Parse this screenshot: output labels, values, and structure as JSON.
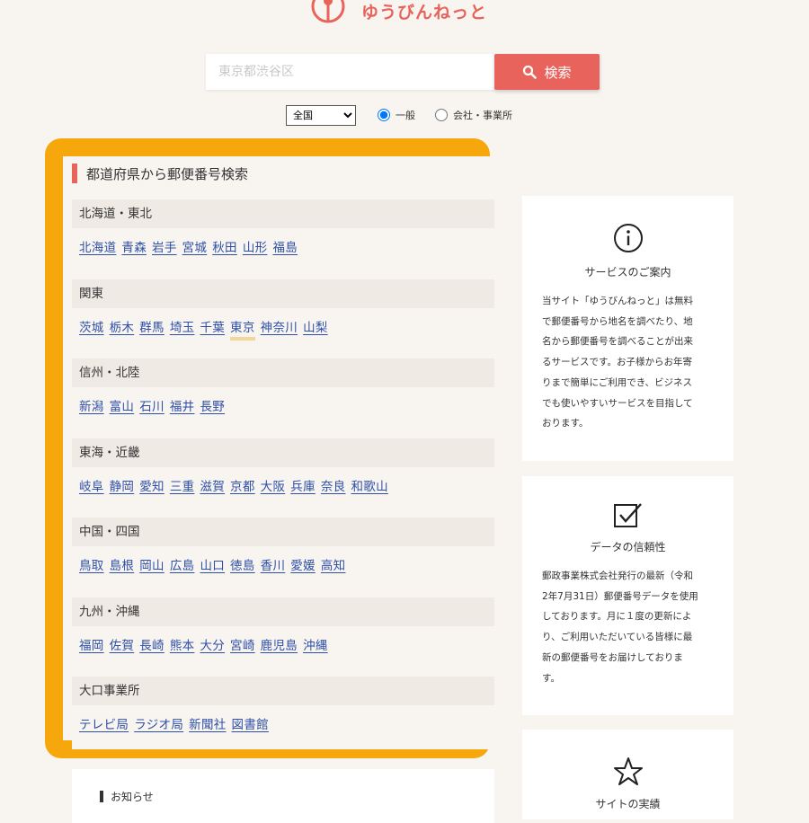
{
  "logo": {
    "text": "ゆうびんねっと"
  },
  "search": {
    "placeholder": "東京都渋谷区",
    "button_label": "検索"
  },
  "options": {
    "area_select": "全国",
    "radio_general": "一般",
    "radio_company": "会社・事業所"
  },
  "panel": {
    "title": "都道府県から郵便番号検索"
  },
  "regions": [
    {
      "name": "北海道・東北",
      "items": [
        "北海道",
        "青森",
        "岩手",
        "宮城",
        "秋田",
        "山形",
        "福島"
      ]
    },
    {
      "name": "関東",
      "items": [
        "茨城",
        "栃木",
        "群馬",
        "埼玉",
        "千葉",
        "東京",
        "神奈川",
        "山梨"
      ]
    },
    {
      "name": "信州・北陸",
      "items": [
        "新潟",
        "富山",
        "石川",
        "福井",
        "長野"
      ]
    },
    {
      "name": "東海・近畿",
      "items": [
        "岐阜",
        "静岡",
        "愛知",
        "三重",
        "滋賀",
        "京都",
        "大阪",
        "兵庫",
        "奈良",
        "和歌山"
      ]
    },
    {
      "name": "中国・四国",
      "items": [
        "鳥取",
        "島根",
        "岡山",
        "広島",
        "山口",
        "徳島",
        "香川",
        "愛媛",
        "高知"
      ]
    },
    {
      "name": "九州・沖縄",
      "items": [
        "福岡",
        "佐賀",
        "長崎",
        "熊本",
        "大分",
        "宮崎",
        "鹿児島",
        "沖縄"
      ]
    },
    {
      "name": "大口事業所",
      "items": [
        "テレビ局",
        "ラジオ局",
        "新聞社",
        "図書館"
      ]
    }
  ],
  "side": {
    "service": {
      "title": "サービスのご案内",
      "icon": "info-icon",
      "lines": [
        "当サイト「ゆうびんねっと」は無料",
        "で郵便番号から地名を調べたり、地",
        "名から郵便番号を調べることが出来",
        "るサービスです。お子様からお年寄",
        "りまで簡単にご利用でき、ビジネス",
        "でも使いやすいサービスを目指して",
        "おります。"
      ]
    },
    "reliability": {
      "title": "データの信頼性",
      "icon": "checkbox-icon",
      "lines": [
        "郵政事業株式会社発行の最新（令和",
        "2年7月31日）郵便番号データを使用",
        "しております。月に１度の更新によ",
        "り、ご利用いただいている皆様に最",
        "新の郵便番号をお届けしておりま",
        "す。"
      ]
    },
    "achievements": {
      "title": "サイトの実績",
      "icon": "star-icon"
    }
  },
  "notice": {
    "title": "お知らせ"
  },
  "colors": {
    "accent": "#e8635b",
    "highlight_border": "#f5a70c",
    "link": "#2e4fa8"
  }
}
